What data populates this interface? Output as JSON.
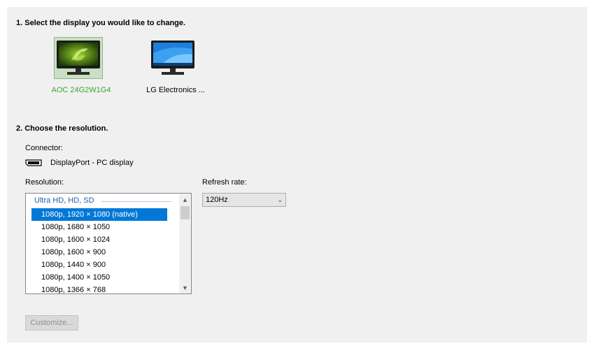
{
  "step1": {
    "heading": "1. Select the display you would like to change."
  },
  "displays": [
    {
      "name": "AOC 24G2W1G4",
      "selected": true
    },
    {
      "name": "LG Electronics ...",
      "selected": false
    }
  ],
  "step2": {
    "heading": "2. Choose the resolution."
  },
  "connector": {
    "label": "Connector:",
    "value": "DisplayPort - PC display"
  },
  "resolution": {
    "label": "Resolution:",
    "group": "Ultra HD, HD, SD",
    "items": [
      "1080p, 1920 × 1080 (native)",
      "1080p, 1680 × 1050",
      "1080p, 1600 × 1024",
      "1080p, 1600 × 900",
      "1080p, 1440 × 900",
      "1080p, 1400 × 1050",
      "1080p, 1366 × 768"
    ],
    "selected_index": 0
  },
  "refresh": {
    "label": "Refresh rate:",
    "value": "120Hz"
  },
  "customize": {
    "label": "Customize..."
  },
  "colors": {
    "accent": "#0078d7",
    "selected_text": "#3aa52f",
    "nvidia_green": "#76b900"
  }
}
